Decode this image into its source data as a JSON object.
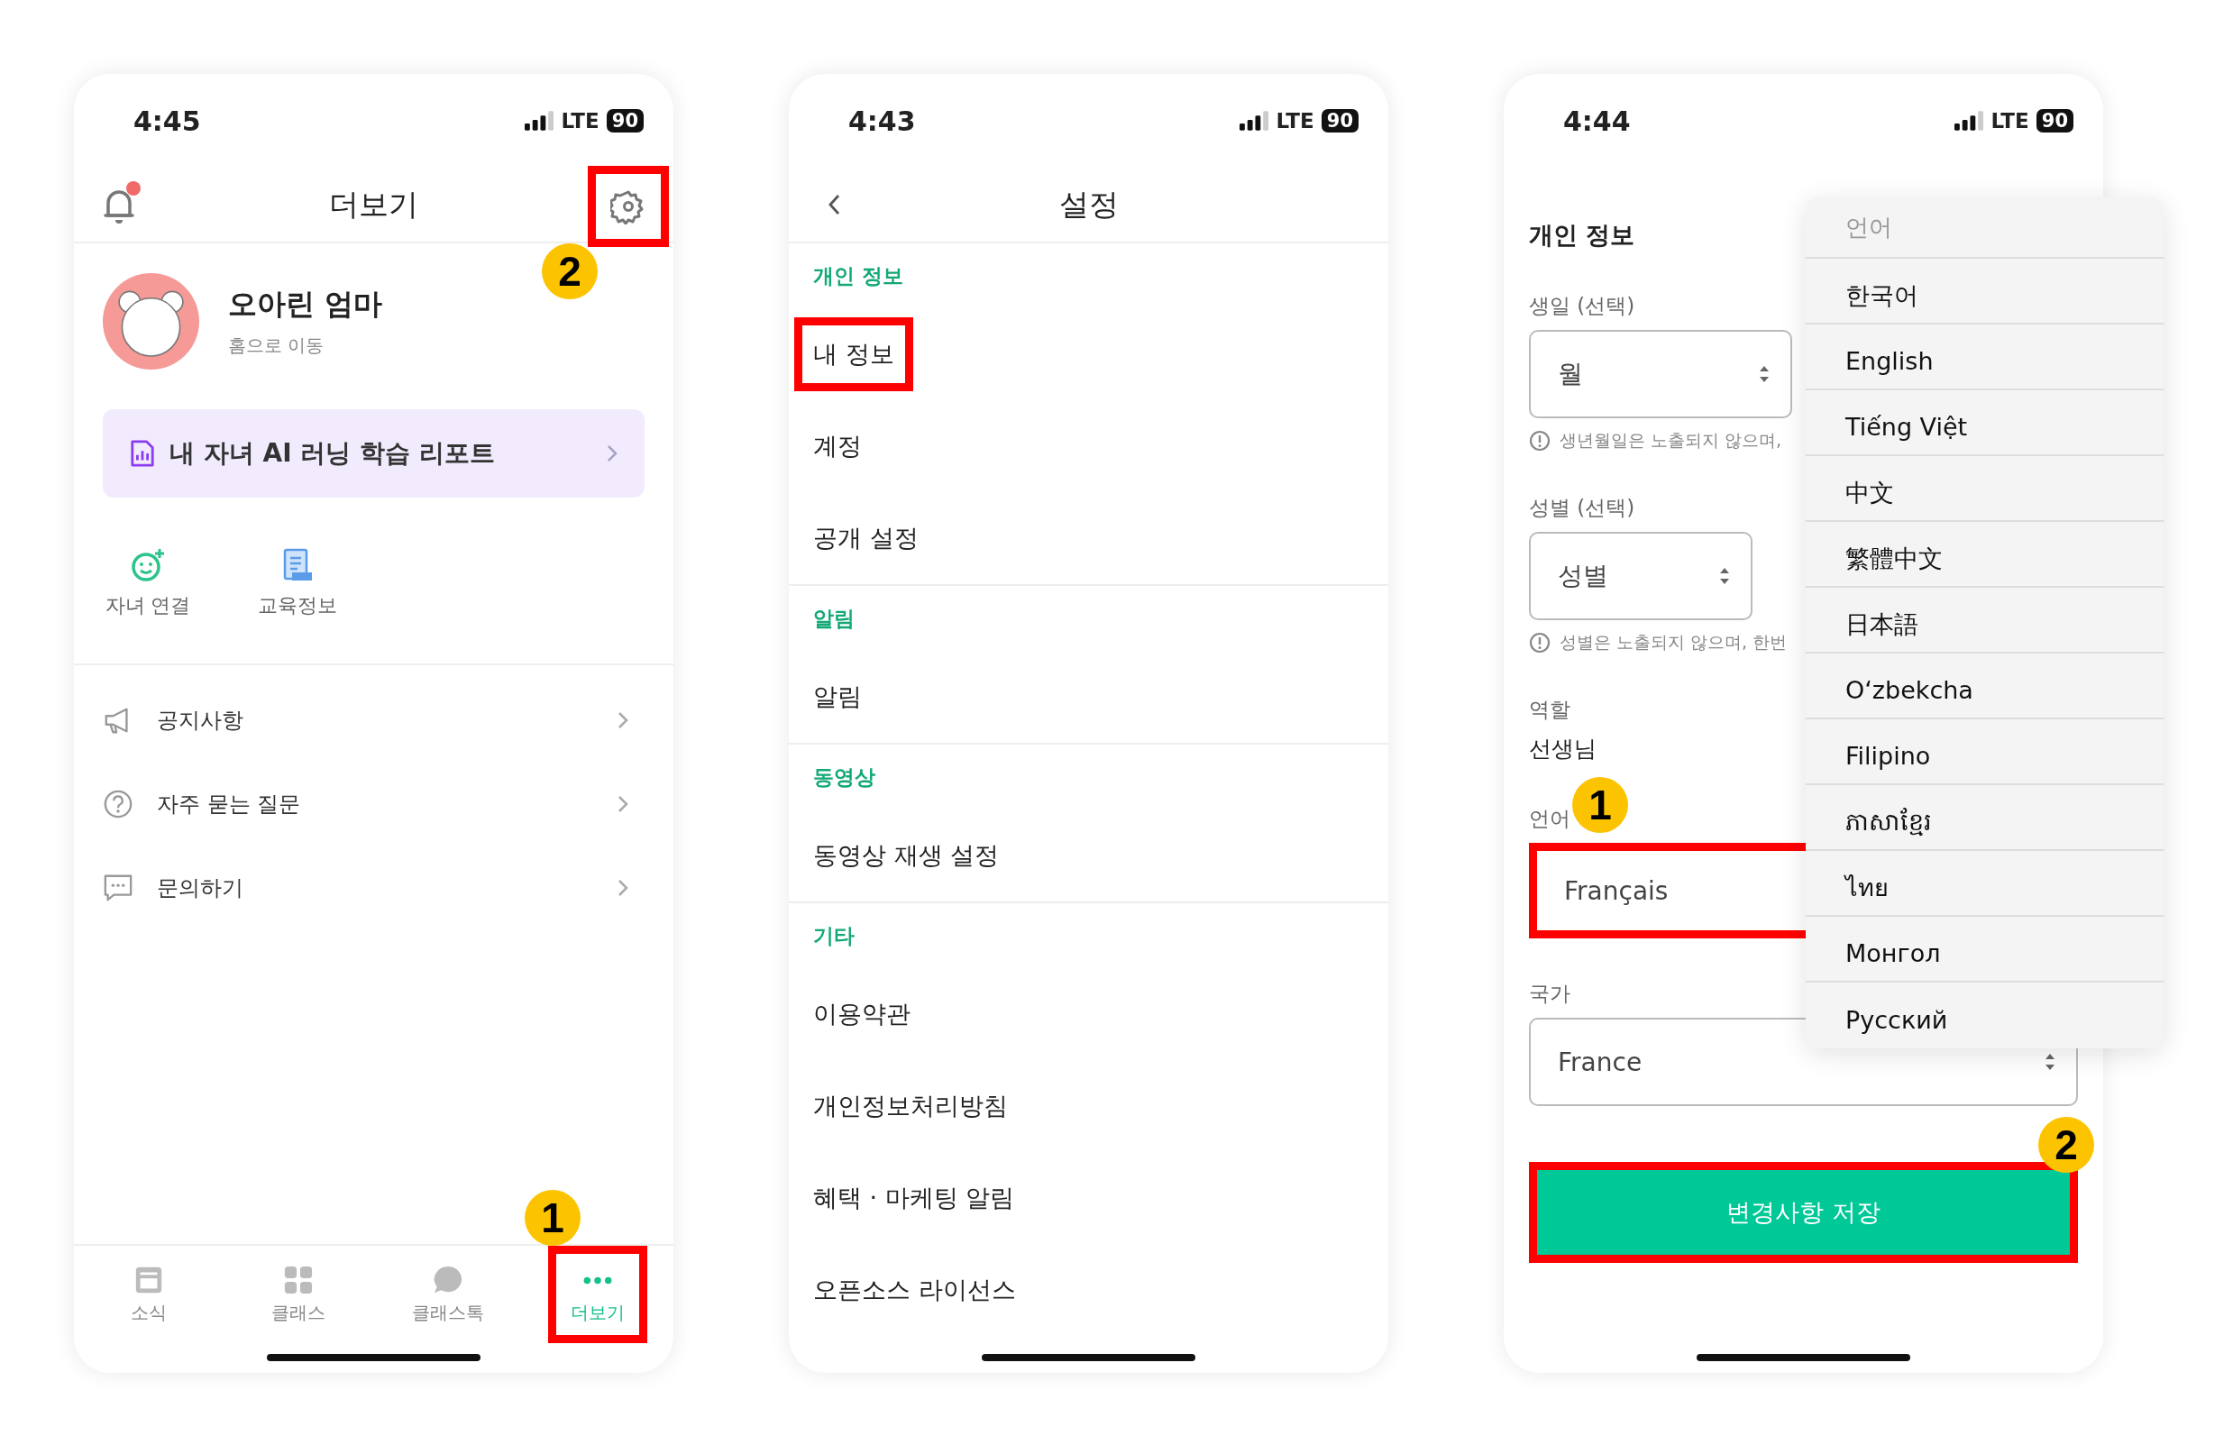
{
  "screens": [
    {
      "kind": "more",
      "status": {
        "time": "4:45",
        "network": "LTE",
        "battery": "90"
      },
      "header": {
        "title": "더보기",
        "has_notification": true,
        "settings_highlighted": true,
        "settings_callout": "2"
      },
      "profile": {
        "name": "오아린 엄마",
        "link": "홈으로 이동"
      },
      "banner": "내 자녀 AI 러닝 학습 리포트",
      "shortcuts": [
        {
          "label": "자녀 연결",
          "kind": "child"
        },
        {
          "label": "교육정보",
          "kind": "info"
        }
      ],
      "menu": [
        {
          "label": "공지사항",
          "kind": "notice"
        },
        {
          "label": "자주 묻는 질문",
          "kind": "faq"
        },
        {
          "label": "문의하기",
          "kind": "contact"
        }
      ],
      "tabs": [
        {
          "label": "소식",
          "kind": "news",
          "selected": false,
          "highlighted": false
        },
        {
          "label": "클래스",
          "kind": "grid",
          "selected": false,
          "highlighted": false
        },
        {
          "label": "클래스톡",
          "kind": "chat",
          "selected": false,
          "highlighted": false
        },
        {
          "label": "더보기",
          "kind": "more",
          "selected": true,
          "highlighted": true,
          "callout": "1"
        }
      ]
    },
    {
      "kind": "settings",
      "status": {
        "time": "4:43",
        "network": "LTE",
        "battery": "90"
      },
      "title": "설정",
      "sections": [
        {
          "label": "개인 정보",
          "items": [
            {
              "label": "내 정보",
              "highlighted": true
            },
            {
              "label": "계정",
              "highlighted": false
            },
            {
              "label": "공개 설정",
              "highlighted": false
            }
          ]
        },
        {
          "label": "알림",
          "items": [
            {
              "label": "알림",
              "highlighted": false
            }
          ]
        },
        {
          "label": "동영상",
          "items": [
            {
              "label": "동영상 재생 설정",
              "highlighted": false
            }
          ]
        },
        {
          "label": "기타",
          "items": [
            {
              "label": "이용약관",
              "highlighted": false
            },
            {
              "label": "개인정보처리방침",
              "highlighted": false
            },
            {
              "label": "혜택 · 마케팅 알림",
              "highlighted": false
            },
            {
              "label": "오픈소스 라이선스",
              "highlighted": false
            }
          ]
        }
      ]
    },
    {
      "kind": "profile_form",
      "status": {
        "time": "4:44",
        "network": "LTE",
        "battery": "90"
      },
      "section_title": "개인 정보",
      "fields": [
        {
          "kind": "select",
          "label": "생일 (선택)",
          "value": "월",
          "hint": "생년월일은 노출되지 않으며,"
        },
        {
          "kind": "select",
          "label": "성별 (선택)",
          "value": "성별",
          "hint": "성별은 노출되지 않으며, 한번"
        },
        {
          "kind": "static",
          "label": "역할",
          "value": "선생님"
        },
        {
          "kind": "picker",
          "label": "언어",
          "value": "Français",
          "highlighted": true,
          "callout": "1"
        },
        {
          "kind": "select",
          "label": "국가",
          "value": "France"
        }
      ],
      "save": {
        "label": "변경사항 저장",
        "highlighted": true,
        "callout": "2"
      },
      "dropdown": {
        "title": "언어",
        "options": [
          "한국어",
          "English",
          "Tiếng Việt",
          "中文",
          "繁體中文",
          "日本語",
          "O‘zbekcha",
          "Filipino",
          "ភាសាខ្មែរ",
          "ไทย",
          "Монгол",
          "Русский"
        ]
      }
    }
  ]
}
